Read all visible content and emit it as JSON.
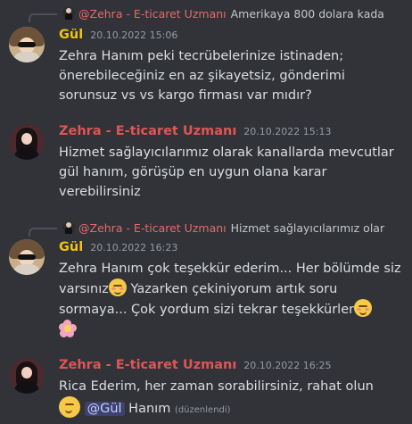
{
  "replies": [
    {
      "author": "@Zehra - E-ticaret Uzmanı",
      "preview": "Amerikaya 800 dolara kada"
    },
    {
      "author": "@Zehra - E-ticaret Uzmanı",
      "preview": "Hizmet sağlayıcılarımız olar"
    }
  ],
  "messages": [
    {
      "author": "Gül",
      "time": "20.10.2022 15:06",
      "text": "Zehra Hanım peki tecrübelerinize istinaden; önerebileceğiniz en az şikayetsiz, gönderimi sorunsuz vs vs kargo firması var mıdır?"
    },
    {
      "author": "Zehra - E-ticaret Uzmanı",
      "time": "20.10.2022 15:13",
      "text": "Hizmet sağlayıcılarımız olarak kanallarda mevcutlar gül hanım, görüşüp en uygun olana karar verebilirsiniz"
    },
    {
      "author": "Gül",
      "time": "20.10.2022 16:23",
      "text_1": "Zehra Hanım çok teşekkür ederim... Her bölümde siz varsınız",
      "text_2": " Yazarken çekiniyorum artık soru sormaya... Çok yordum sizi tekrar teşekkürler"
    },
    {
      "author": "Zehra - E-ticaret Uzmanı",
      "time": "20.10.2022 16:25",
      "text": "Rica Ederim, her zaman sorabilirsiniz, rahat olun",
      "mention": "@Gül",
      "after": " Hanım",
      "edited": "(düzenlendi)"
    }
  ],
  "icons": [
    "smiling-blush-emoji",
    "cherry-blossom-emoji",
    "slightly-smiling-emoji"
  ],
  "colors": {
    "background": "#313338",
    "gul": "#f1c40f",
    "zehra": "#e05555",
    "mention_bg": "#3c4270"
  }
}
